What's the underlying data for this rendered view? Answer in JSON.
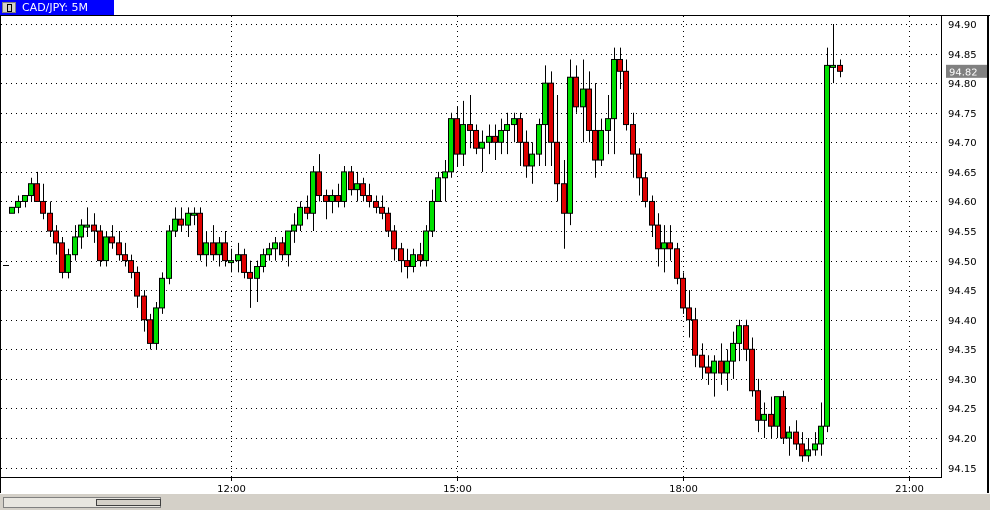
{
  "window": {
    "title": "CAD/JPY: 5M"
  },
  "colors": {
    "up": "#00e000",
    "down": "#e00000",
    "wick": "#000000",
    "grid": "#000000",
    "price_tag": "#808080"
  },
  "chart_data": {
    "type": "candlestick",
    "symbol": "CAD/JPY",
    "timeframe": "5M",
    "ylim": [
      94.13,
      94.92
    ],
    "y_ticks": [
      "94.90",
      "94.85",
      "94.80",
      "94.75",
      "94.70",
      "94.65",
      "94.60",
      "94.55",
      "94.50",
      "94.45",
      "94.40",
      "94.35",
      "94.30",
      "94.25",
      "94.20",
      "94.15"
    ],
    "x_ticks": [
      {
        "label": "12:00",
        "index": 35
      },
      {
        "label": "15:00",
        "index": 71
      },
      {
        "label": "18:00",
        "index": 107
      },
      {
        "label": "21:00",
        "index": 143
      }
    ],
    "current_price": "94.82",
    "candles": [
      [
        94.58,
        94.59,
        94.58,
        94.59
      ],
      [
        94.59,
        94.61,
        94.58,
        94.6
      ],
      [
        94.6,
        94.61,
        94.59,
        94.61
      ],
      [
        94.61,
        94.64,
        94.6,
        94.63
      ],
      [
        94.63,
        94.65,
        94.6,
        94.6
      ],
      [
        94.6,
        94.63,
        94.57,
        94.58
      ],
      [
        94.58,
        94.6,
        94.54,
        94.55
      ],
      [
        94.55,
        94.56,
        94.51,
        94.53
      ],
      [
        94.53,
        94.54,
        94.47,
        94.48
      ],
      [
        94.48,
        94.52,
        94.47,
        94.51
      ],
      [
        94.51,
        94.56,
        94.5,
        94.54
      ],
      [
        94.54,
        94.57,
        94.52,
        94.56
      ],
      [
        94.56,
        94.59,
        94.54,
        94.56
      ],
      [
        94.56,
        94.58,
        94.53,
        94.55
      ],
      [
        94.55,
        94.56,
        94.49,
        94.5
      ],
      [
        94.5,
        94.55,
        94.49,
        94.54
      ],
      [
        94.54,
        94.56,
        94.52,
        94.53
      ],
      [
        94.53,
        94.55,
        94.5,
        94.51
      ],
      [
        94.51,
        94.53,
        94.49,
        94.5
      ],
      [
        94.5,
        94.51,
        94.47,
        94.48
      ],
      [
        94.48,
        94.49,
        94.42,
        94.44
      ],
      [
        94.44,
        94.45,
        94.38,
        94.4
      ],
      [
        94.4,
        94.41,
        94.35,
        94.36
      ],
      [
        94.36,
        94.43,
        94.35,
        94.42
      ],
      [
        94.42,
        94.48,
        94.41,
        94.47
      ],
      [
        94.47,
        94.56,
        94.46,
        94.55
      ],
      [
        94.55,
        94.59,
        94.54,
        94.57
      ],
      [
        94.57,
        94.59,
        94.55,
        94.56
      ],
      [
        94.56,
        94.59,
        94.54,
        94.58
      ],
      [
        94.58,
        94.59,
        94.56,
        94.58
      ],
      [
        94.58,
        94.59,
        94.5,
        94.51
      ],
      [
        94.51,
        94.55,
        94.49,
        94.53
      ],
      [
        94.53,
        94.56,
        94.5,
        94.51
      ],
      [
        94.51,
        94.54,
        94.49,
        94.53
      ],
      [
        94.53,
        94.55,
        94.49,
        94.5
      ],
      [
        94.5,
        94.52,
        94.48,
        94.5
      ],
      [
        94.5,
        94.53,
        94.48,
        94.51
      ],
      [
        94.51,
        94.52,
        94.47,
        94.48
      ],
      [
        94.48,
        94.5,
        94.42,
        94.47
      ],
      [
        94.47,
        94.5,
        94.43,
        94.49
      ],
      [
        94.49,
        94.52,
        94.48,
        94.51
      ],
      [
        94.51,
        94.53,
        94.5,
        94.52
      ],
      [
        94.52,
        94.54,
        94.5,
        94.53
      ],
      [
        94.53,
        94.54,
        94.5,
        94.51
      ],
      [
        94.51,
        94.55,
        94.49,
        94.55
      ],
      [
        94.55,
        94.58,
        94.53,
        94.56
      ],
      [
        94.56,
        94.6,
        94.55,
        94.59
      ],
      [
        94.59,
        94.61,
        94.57,
        94.58
      ],
      [
        94.58,
        94.66,
        94.55,
        94.65
      ],
      [
        94.65,
        94.68,
        94.6,
        94.61
      ],
      [
        94.61,
        94.62,
        94.57,
        94.6
      ],
      [
        94.6,
        94.62,
        94.58,
        94.61
      ],
      [
        94.61,
        94.63,
        94.59,
        94.6
      ],
      [
        94.6,
        94.66,
        94.59,
        94.65
      ],
      [
        94.65,
        94.66,
        94.61,
        94.62
      ],
      [
        94.62,
        94.65,
        94.6,
        94.63
      ],
      [
        94.63,
        94.64,
        94.6,
        94.61
      ],
      [
        94.61,
        94.63,
        94.59,
        94.6
      ],
      [
        94.6,
        94.61,
        94.58,
        94.59
      ],
      [
        94.59,
        94.61,
        94.57,
        94.58
      ],
      [
        94.58,
        94.59,
        94.54,
        94.55
      ],
      [
        94.55,
        94.56,
        94.5,
        94.52
      ],
      [
        94.52,
        94.53,
        94.48,
        94.5
      ],
      [
        94.5,
        94.52,
        94.47,
        94.49
      ],
      [
        94.49,
        94.52,
        94.48,
        94.51
      ],
      [
        94.51,
        94.53,
        94.49,
        94.5
      ],
      [
        94.5,
        94.56,
        94.49,
        94.55
      ],
      [
        94.55,
        94.62,
        94.54,
        94.6
      ],
      [
        94.6,
        94.65,
        94.6,
        94.64
      ],
      [
        94.64,
        94.67,
        94.6,
        94.65
      ],
      [
        94.65,
        94.75,
        94.64,
        94.74
      ],
      [
        94.74,
        94.76,
        94.66,
        94.68
      ],
      [
        94.68,
        94.77,
        94.66,
        94.73
      ],
      [
        94.73,
        94.78,
        94.69,
        94.72
      ],
      [
        94.72,
        94.73,
        94.68,
        94.69
      ],
      [
        94.69,
        94.72,
        94.65,
        94.7
      ],
      [
        94.7,
        94.73,
        94.68,
        94.71
      ],
      [
        94.71,
        94.73,
        94.67,
        94.7
      ],
      [
        94.7,
        94.74,
        94.68,
        94.72
      ],
      [
        94.72,
        94.75,
        94.68,
        94.73
      ],
      [
        94.73,
        94.75,
        94.7,
        94.74
      ],
      [
        94.74,
        94.75,
        94.66,
        94.7
      ],
      [
        94.7,
        94.72,
        94.64,
        94.66
      ],
      [
        94.66,
        94.7,
        94.63,
        94.68
      ],
      [
        94.68,
        94.74,
        94.66,
        94.73
      ],
      [
        94.73,
        94.83,
        94.66,
        94.8
      ],
      [
        94.8,
        94.82,
        94.66,
        94.7
      ],
      [
        94.7,
        94.78,
        94.6,
        94.63
      ],
      [
        94.63,
        94.67,
        94.52,
        94.58
      ],
      [
        94.58,
        94.84,
        94.56,
        94.81
      ],
      [
        94.81,
        94.83,
        94.75,
        94.76
      ],
      [
        94.76,
        94.84,
        94.7,
        94.79
      ],
      [
        94.79,
        94.82,
        94.7,
        94.72
      ],
      [
        94.72,
        94.8,
        94.64,
        94.67
      ],
      [
        94.67,
        94.74,
        94.66,
        94.72
      ],
      [
        94.72,
        94.78,
        94.68,
        94.74
      ],
      [
        94.74,
        94.86,
        94.68,
        94.84
      ],
      [
        94.84,
        94.86,
        94.79,
        94.82
      ],
      [
        94.82,
        94.84,
        94.72,
        94.73
      ],
      [
        94.73,
        94.75,
        94.64,
        94.68
      ],
      [
        94.68,
        94.69,
        94.61,
        94.64
      ],
      [
        94.64,
        94.65,
        94.59,
        94.6
      ],
      [
        94.6,
        94.61,
        94.54,
        94.56
      ],
      [
        94.56,
        94.58,
        94.49,
        94.52
      ],
      [
        94.52,
        94.56,
        94.48,
        94.53
      ],
      [
        94.53,
        94.56,
        94.5,
        94.52
      ],
      [
        94.52,
        94.53,
        94.46,
        94.47
      ],
      [
        94.47,
        94.48,
        94.41,
        94.42
      ],
      [
        94.42,
        94.45,
        94.37,
        94.4
      ],
      [
        94.4,
        94.42,
        94.32,
        94.34
      ],
      [
        94.34,
        94.36,
        94.3,
        94.32
      ],
      [
        94.32,
        94.34,
        94.29,
        94.31
      ],
      [
        94.31,
        94.34,
        94.27,
        94.33
      ],
      [
        94.33,
        94.36,
        94.29,
        94.31
      ],
      [
        94.31,
        94.35,
        94.28,
        94.33
      ],
      [
        94.33,
        94.38,
        94.3,
        94.36
      ],
      [
        94.36,
        94.4,
        94.33,
        94.39
      ],
      [
        94.39,
        94.4,
        94.33,
        94.35
      ],
      [
        94.35,
        94.37,
        94.27,
        94.28
      ],
      [
        94.28,
        94.3,
        94.21,
        94.23
      ],
      [
        94.23,
        94.26,
        94.2,
        94.24
      ],
      [
        94.24,
        94.27,
        94.2,
        94.22
      ],
      [
        94.22,
        94.27,
        94.2,
        94.27
      ],
      [
        94.27,
        94.28,
        94.19,
        94.2
      ],
      [
        94.2,
        94.22,
        94.17,
        94.21
      ],
      [
        94.21,
        94.23,
        94.18,
        94.19
      ],
      [
        94.19,
        94.21,
        94.16,
        94.17
      ],
      [
        94.17,
        94.2,
        94.16,
        94.18
      ],
      [
        94.18,
        94.21,
        94.17,
        94.19
      ],
      [
        94.19,
        94.26,
        94.17,
        94.22
      ],
      [
        94.22,
        94.86,
        94.21,
        94.83
      ],
      [
        94.83,
        94.9,
        94.8,
        94.83
      ],
      [
        94.83,
        94.84,
        94.81,
        94.82
      ]
    ]
  }
}
